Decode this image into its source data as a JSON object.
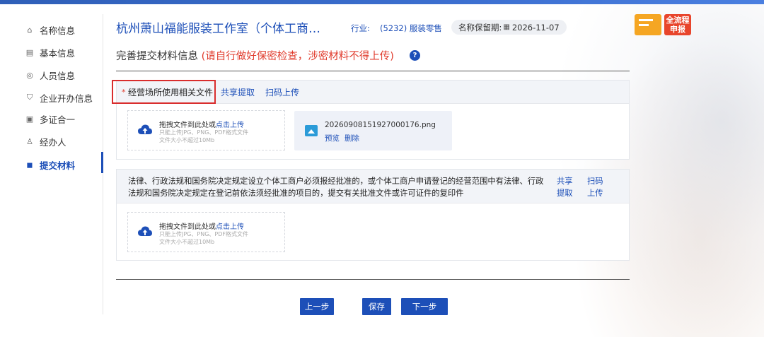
{
  "header": {
    "company": "杭州萧山福能服装工作室（个体工商…",
    "industry_label": "行业:",
    "industry_value": "(5232) 服装零售",
    "keep_label": "名称保留期:",
    "keep_date": "2026-11-07",
    "fullflow_tag": "全流程申报"
  },
  "sidebar": {
    "items": [
      {
        "label": "名称信息",
        "icon": "home-icon"
      },
      {
        "label": "基本信息",
        "icon": "document-icon"
      },
      {
        "label": "人员信息",
        "icon": "person-icon"
      },
      {
        "label": "企业开办信息",
        "icon": "shield-icon"
      },
      {
        "label": "多证合一",
        "icon": "certificate-icon"
      },
      {
        "label": "经办人",
        "icon": "agent-icon"
      },
      {
        "label": "提交材料",
        "icon": "submit-icon"
      }
    ],
    "active_index": 6
  },
  "section": {
    "title": "完善提交材料信息",
    "warning": "(请自行做好保密检查，涉密材料不得上传)"
  },
  "panel1": {
    "required_mark": "*",
    "label": "经营场所使用相关文件",
    "share": "共享提取",
    "scan": "扫码上传",
    "dropzone": {
      "line1_prefix": "拖拽文件到此处或",
      "line1_link": "点击上传",
      "line2": "只能上传JPG、PNG、PDF格式文件",
      "line3": "文件大小不超过10Mb"
    },
    "file": {
      "name": "20260908151927000176.png",
      "preview": "预览",
      "delete": "删除"
    }
  },
  "panel2": {
    "text": "法律、行政法规和国务院决定规定设立个体工商户必须报经批准的，或个体工商户申请登记的经营范围中有法律、行政法规和国务院决定规定在登记前依法须经批准的项目的，提交有关批准文件或许可证件的复印件",
    "share": "共享提取",
    "scan": "扫码上传",
    "dropzone": {
      "line1_prefix": "拖拽文件到此处或",
      "line1_link": "点击上传",
      "line2": "只能上传JPG、PNG、PDF格式文件",
      "line3": "文件大小不超过10Mb"
    }
  },
  "buttons": {
    "prev": "上一步",
    "save": "保存",
    "next": "下一步"
  },
  "colors": {
    "primary": "#1d4fb8",
    "warning": "#e03b2c",
    "highlight_box": "#d92d2d"
  }
}
